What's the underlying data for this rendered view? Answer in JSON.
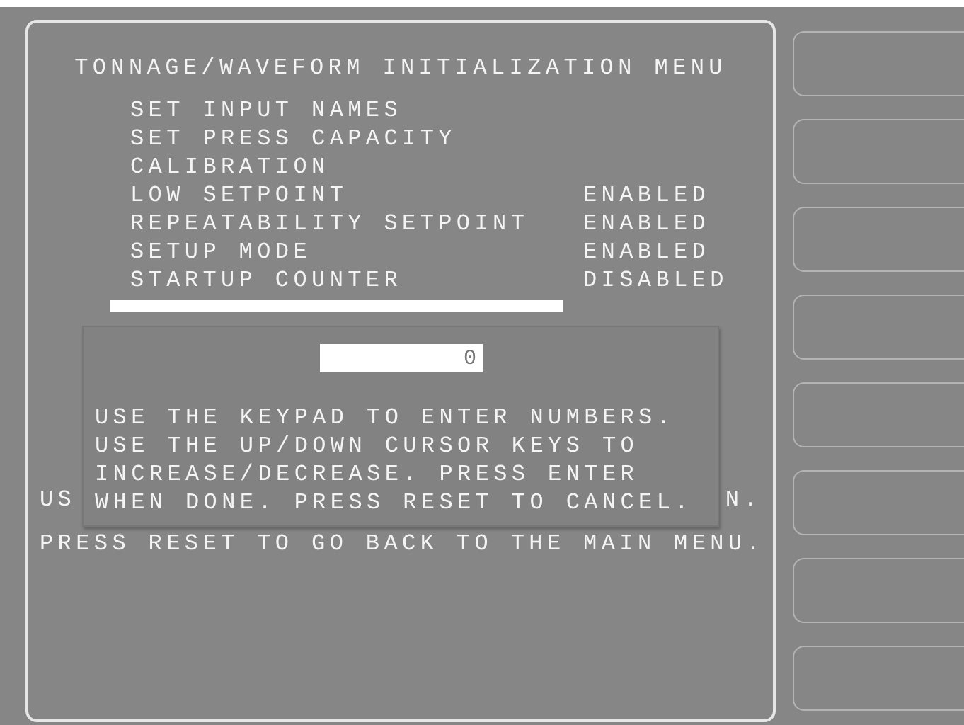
{
  "title": "TONNAGE/WAVEFORM INITIALIZATION MENU",
  "menu_items": [
    {
      "label": "SET INPUT NAMES"
    },
    {
      "label": "SET PRESS CAPACITY"
    },
    {
      "label": "CALIBRATION"
    },
    {
      "label": "LOW SETPOINT",
      "status": "ENABLED"
    },
    {
      "label": "REPEATABILITY SETPOINT",
      "status": "ENABLED"
    },
    {
      "label": "SETUP MODE",
      "status": "ENABLED"
    },
    {
      "label": "STARTUP COUNTER",
      "status": "DISABLED"
    }
  ],
  "dialog": {
    "value": "0",
    "message": [
      "USE THE KEYPAD TO ENTER NUMBERS.",
      "USE THE UP/DOWN CURSOR KEYS TO",
      "INCREASE/DECREASE. PRESS ENTER",
      "WHEN DONE. PRESS RESET TO CANCEL."
    ]
  },
  "footer": {
    "left_fragment": "US",
    "right_fragment": "N.",
    "line": "PRESS RESET TO GO BACK TO THE MAIN MENU."
  }
}
